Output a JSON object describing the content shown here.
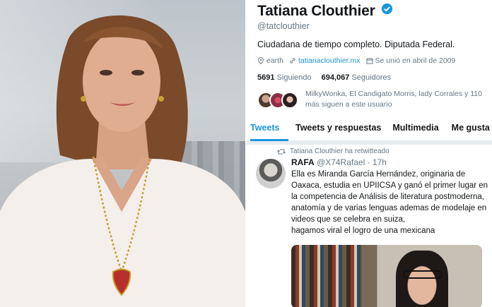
{
  "photo": {
    "alt_name": "portrait-photo"
  },
  "profile": {
    "name": "Tatiana Clouthier",
    "handle": "@tatclouthier",
    "bio": "Ciudadana de tiempo completo. Diputada Federal.",
    "location": "earth",
    "website": "tatianaclouthier.mx",
    "joined": "Se unió en abril de 2009",
    "following_count": "5691",
    "following_label": "Siguiendo",
    "followers_count": "694,067",
    "followers_label": "Seguidores",
    "followers_you_know": "MilkyWonka, El Candigato Morris, lady Corrales y 110 más siguen a este usuario"
  },
  "tabs": [
    {
      "label": "Tweets",
      "active": true
    },
    {
      "label": "Tweets y respuestas",
      "active": false
    },
    {
      "label": "Multimedia",
      "active": false
    },
    {
      "label": "Me gusta",
      "active": false
    }
  ],
  "tweet": {
    "retweeted_by": "Tatiana Clouthier ha retwitteado",
    "author": "RAFA",
    "author_handle": "@X74Rafael · 17h",
    "text": "Ella es Miranda García Hernández, originaria de Oaxaca, estudia en UPIICSA y ganó el primer lugar en la competencia de Análisis de literatura postmoderna, anatomía y de varias lenguas ademas de modelaje en videos que se celebra en suiza,\nhagamos viral el logro de una mexicana"
  },
  "colors": {
    "accent": "#1b95e0",
    "text": "#14171a",
    "muted": "#657786"
  },
  "icons": [
    "verified-badge-icon",
    "location-icon",
    "link-icon",
    "calendar-icon",
    "retweet-icon"
  ]
}
